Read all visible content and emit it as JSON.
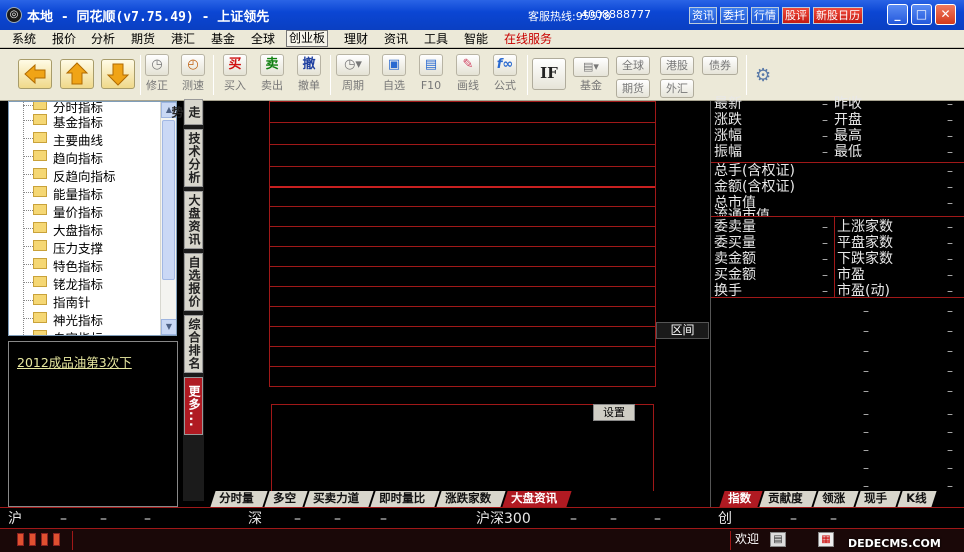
{
  "window": {
    "title": "本地 - 同花顺(v7.75.49) - 上证领先",
    "hotline_label": "客服热线:95578",
    "hotline_numbers": "4008888777",
    "title_buttons": [
      {
        "label": "资讯",
        "color": "#2a64e6"
      },
      {
        "label": "委托",
        "color": "#2a64e6"
      },
      {
        "label": "行情",
        "color": "#2a64e6"
      },
      {
        "label": "股评",
        "color": "#d42318"
      },
      {
        "label": "新股日历",
        "color": "#d42318"
      }
    ]
  },
  "menu": [
    "系统",
    "报价",
    "分析",
    "期货",
    "港汇",
    "基金",
    "全球",
    "创业板",
    "理财",
    "资讯",
    "工具",
    "智能",
    "在线服务"
  ],
  "toolbar": {
    "tools": [
      {
        "glyph": "◷",
        "label": "修正"
      },
      {
        "glyph": "◴",
        "label": "测速"
      },
      {
        "glyph": "买",
        "label": "买入"
      },
      {
        "glyph": "卖",
        "label": "卖出"
      },
      {
        "glyph": "撤",
        "label": "撤单"
      },
      {
        "glyph": "◷▾",
        "label": "周期"
      },
      {
        "glyph": "▣",
        "label": "自选"
      },
      {
        "glyph": "▤",
        "label": "F10"
      },
      {
        "glyph": "✎",
        "label": "画线"
      },
      {
        "glyph": "f∞",
        "label": "公式"
      }
    ],
    "if_label": "IF",
    "fund_label": "基金",
    "small_buttons": [
      "全球",
      "港股",
      "债券",
      "期货",
      "外汇"
    ]
  },
  "tree": {
    "items": [
      "分时指标",
      "基金指标",
      "主要曲线",
      "趋向指标",
      "反趋向指标",
      "能量指标",
      "量价指标",
      "大盘指标",
      "压力支撑",
      "特色指标",
      "铑龙指标",
      "指南针",
      "神光指标",
      "自定指标"
    ]
  },
  "news": {
    "link": "2012成品油第3次下"
  },
  "vtabs": [
    "走势",
    "技术分析",
    "大盘资讯",
    "自选报价",
    "综合排名",
    "更多..."
  ],
  "main": {
    "interval_label": "区间",
    "settings_label": "设置",
    "tabs": [
      "分时量",
      "多空",
      "买卖力道",
      "即时量比",
      "涨跌家数",
      "大盘资讯"
    ]
  },
  "right_panel": {
    "row1": [
      [
        "最新",
        "昨收"
      ],
      [
        "涨跌",
        "开盘"
      ],
      [
        "涨幅",
        "最高"
      ],
      [
        "振幅",
        "最低"
      ]
    ],
    "row2": [
      "总手(含权证)",
      "金额(含权证)",
      "总市值",
      "流通市值"
    ],
    "row3": [
      [
        "委卖量",
        "上涨家数"
      ],
      [
        "委买量",
        "平盘家数"
      ],
      [
        "卖金额",
        "下跌家数"
      ],
      [
        "买金额",
        "市盈"
      ],
      [
        "换手",
        "市盈(动)"
      ]
    ],
    "dash": "–",
    "tabs": [
      "指数",
      "贡献度",
      "领涨",
      "现手",
      "K线"
    ]
  },
  "status": {
    "markets": [
      "沪",
      "深",
      "沪深300",
      "创"
    ],
    "dash": "–",
    "welcome": "欢迎",
    "watermark": "DEDECMS.COM"
  }
}
